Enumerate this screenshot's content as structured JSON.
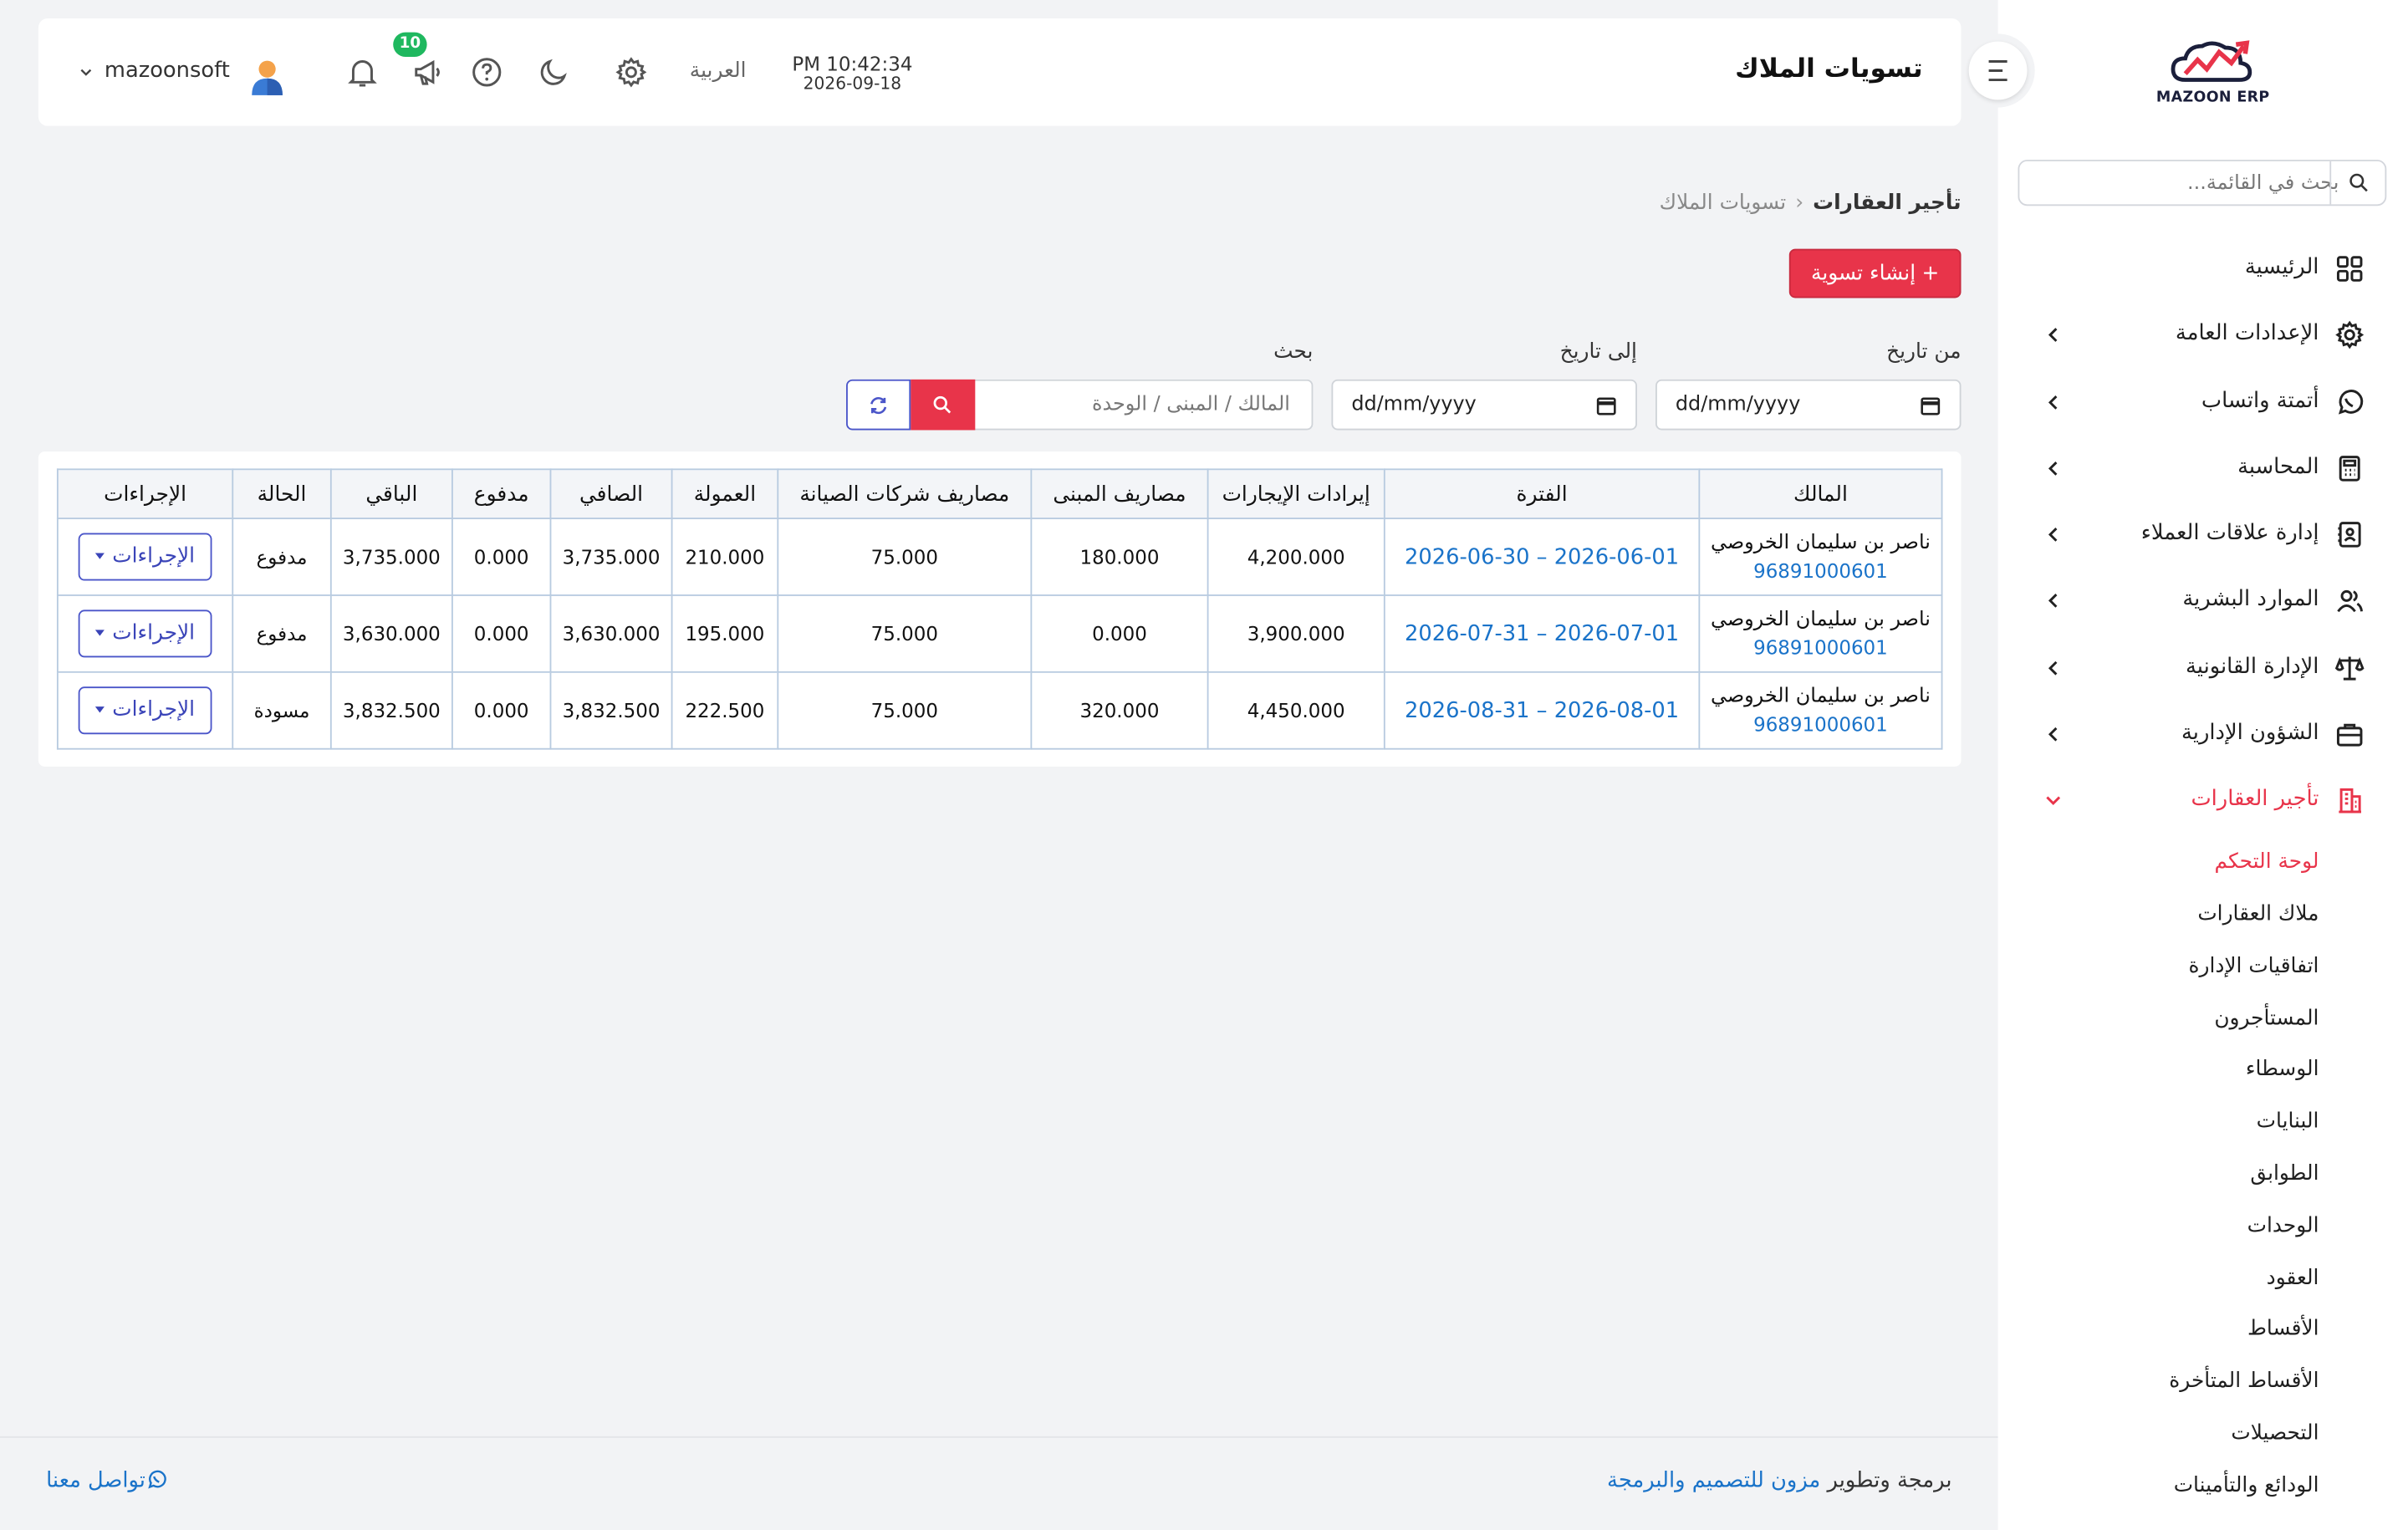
{
  "colors": {
    "accent": "#e8344a",
    "link": "#1a73c9",
    "primary_outline": "#4a55c9",
    "badge": "#1fb85f"
  },
  "sidebar": {
    "logo_text": "MAZOON ERP",
    "search_placeholder": "بحث في القائمة...",
    "items": [
      {
        "label": "الرئيسية",
        "icon": "grid-icon"
      },
      {
        "label": "الإعدادات العامة",
        "icon": "gear-icon"
      },
      {
        "label": "أتمتة واتساب",
        "icon": "whatsapp-icon"
      },
      {
        "label": "المحاسبة",
        "icon": "calculator-icon"
      },
      {
        "label": "إدارة علاقات العملاء",
        "icon": "contacts-icon"
      },
      {
        "label": "الموارد البشرية",
        "icon": "users-icon"
      },
      {
        "label": "الإدارة القانونية",
        "icon": "scale-icon"
      },
      {
        "label": "الشؤون الإدارية",
        "icon": "briefcase-icon"
      },
      {
        "label": "تأجير العقارات",
        "icon": "building-icon"
      }
    ],
    "subitems": [
      "لوحة التحكم",
      "ملاك العقارات",
      "اتفاقيات الإدارة",
      "المستأجرون",
      "الوسطاء",
      "البنايات",
      "الطوابق",
      "الوحدات",
      "العقود",
      "الأقساط",
      "الأقساط المتأخرة",
      "التحصيلات",
      "الودائع والتأمينات"
    ]
  },
  "header": {
    "title": "تسويات الملاك",
    "time": "PM 10:42:34",
    "date": "2026-09-18",
    "language": "العربية",
    "notification_count": "10",
    "username": "mazoonsoft"
  },
  "breadcrumb": {
    "parent": "تأجير العقارات",
    "current": "تسويات الملاك"
  },
  "create_button": {
    "label": "إنشاء تسوية",
    "plus": "+"
  },
  "filters": {
    "from_label": "من تاريخ",
    "to_label": "إلى تاريخ",
    "search_label": "بحث",
    "date_placeholder": "dd/mm/yyyy",
    "search_placeholder": "المالك / المبنى / الوحدة"
  },
  "table": {
    "headers": [
      "المالك",
      "الفترة",
      "إيرادات الإيجارات",
      "مصاريف المبنى",
      "مصاريف شركات الصيانة",
      "العمولة",
      "الصافي",
      "مدفوع",
      "الباقي",
      "الحالة",
      "الإجراءات"
    ],
    "rows": [
      {
        "owner": "ناصر بن سليمان الخروصي",
        "phone": "96891000601",
        "period": "2026-06-01 – 2026-06-30",
        "rent": "4,200.000",
        "building": "180.000",
        "maintenance": "75.000",
        "commission": "210.000",
        "net": "3,735.000",
        "paid": "0.000",
        "remaining": "3,735.000",
        "status": "مدفوع",
        "action": "الإجراءات"
      },
      {
        "owner": "ناصر بن سليمان الخروصي",
        "phone": "96891000601",
        "period": "2026-07-01 – 2026-07-31",
        "rent": "3,900.000",
        "building": "0.000",
        "maintenance": "75.000",
        "commission": "195.000",
        "net": "3,630.000",
        "paid": "0.000",
        "remaining": "3,630.000",
        "status": "مدفوع",
        "action": "الإجراءات"
      },
      {
        "owner": "ناصر بن سليمان الخروصي",
        "phone": "96891000601",
        "period": "2026-08-01 – 2026-08-31",
        "rent": "4,450.000",
        "building": "320.000",
        "maintenance": "75.000",
        "commission": "222.500",
        "net": "3,832.500",
        "paid": "0.000",
        "remaining": "3,832.500",
        "status": "مسودة",
        "action": "الإجراءات"
      }
    ]
  },
  "footer": {
    "credit_prefix": "برمجة وتطوير",
    "credit_brand": "مزون للتصميم والبرمجة",
    "contact": "تواصل معنا"
  }
}
